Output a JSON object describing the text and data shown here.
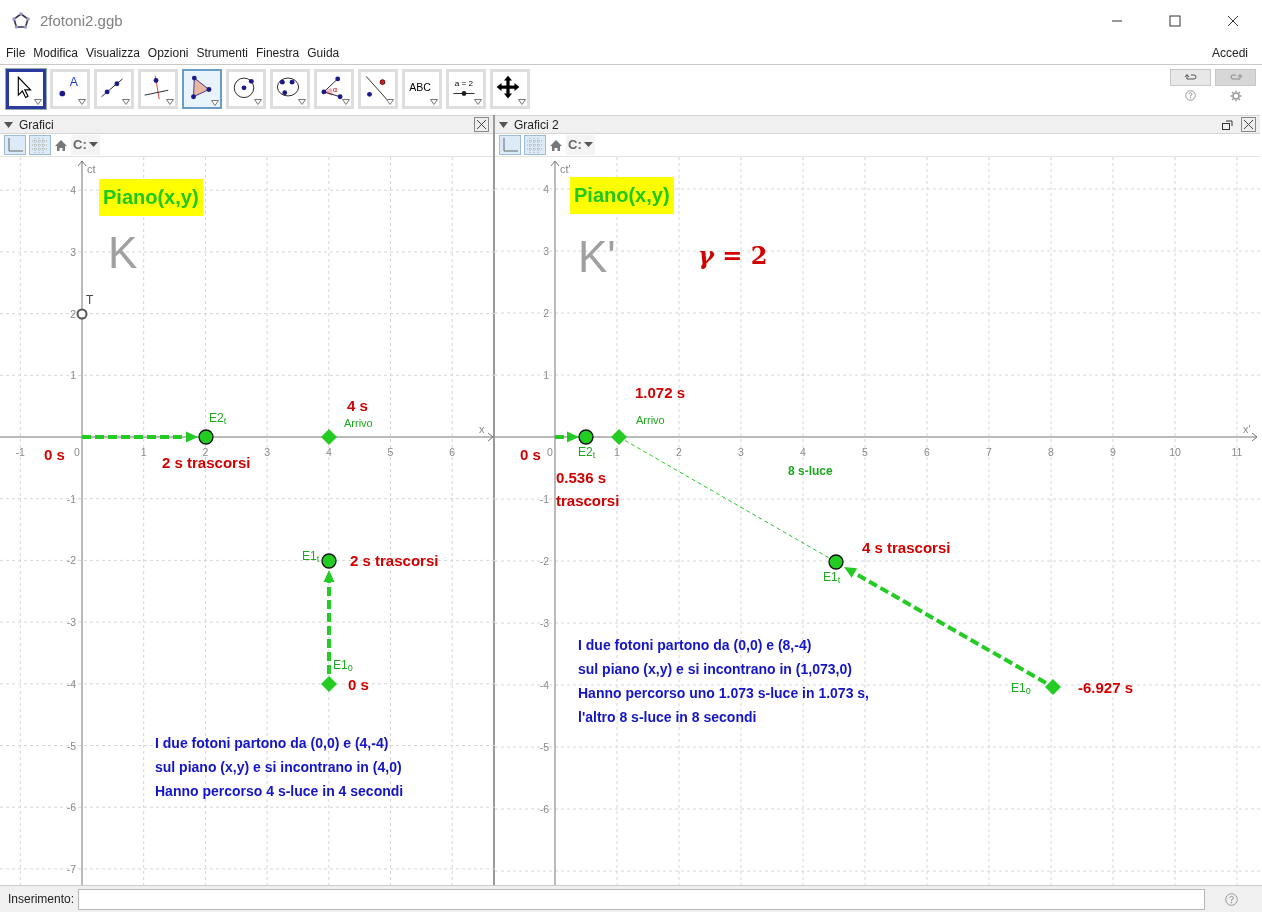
{
  "window": {
    "title": "2fotoni2.ggb"
  },
  "menu": [
    "File",
    "Modifica",
    "Visualizza",
    "Opzioni",
    "Strumenti",
    "Finestra",
    "Guida"
  ],
  "account": "Accedi",
  "tools": [
    {
      "kind": "pointer",
      "selected": true,
      "hovered": false
    },
    {
      "kind": "point",
      "text": "A",
      "selected": false,
      "hovered": false
    },
    {
      "kind": "line",
      "selected": false,
      "hovered": false
    },
    {
      "kind": "perpendicular",
      "selected": false,
      "hovered": false
    },
    {
      "kind": "polygon",
      "selected": false,
      "hovered": true
    },
    {
      "kind": "circle",
      "selected": false,
      "hovered": false
    },
    {
      "kind": "conic",
      "selected": false,
      "hovered": false
    },
    {
      "kind": "angle",
      "text": "α",
      "selected": false,
      "hovered": false
    },
    {
      "kind": "reflect",
      "selected": false,
      "hovered": false
    },
    {
      "kind": "text",
      "text": "ABC",
      "selected": false,
      "hovered": false
    },
    {
      "kind": "slider",
      "text": "a = 2",
      "selected": false,
      "hovered": false
    },
    {
      "kind": "move_view",
      "selected": false,
      "hovered": false
    }
  ],
  "history": {
    "undo_disabled": false,
    "redo_disabled": true
  },
  "panels": [
    {
      "title": "Grafici",
      "detachable": false,
      "style_bar": {
        "axes_on": true,
        "grid_on": true,
        "capture": "C:"
      },
      "axes": {
        "x_label": "x",
        "y_label": "ct",
        "x_ticks": [
          "-1",
          "0",
          "1",
          "2",
          "3",
          "4",
          "5",
          "6"
        ],
        "y_ticks": [
          "4",
          "3",
          "2",
          "1",
          "-1",
          "-2",
          "-3",
          "-4",
          "-5",
          "-6",
          "-7"
        ]
      },
      "points": [
        {
          "kind": "hollow",
          "label": "T"
        },
        {
          "kind": "circle",
          "label": "E2$_{t}$"
        },
        {
          "kind": "diamond"
        },
        {
          "kind": "circle",
          "label": "E1$_{t}$"
        },
        {
          "kind": "diamond",
          "label": "E1$_{0}$"
        }
      ],
      "texts": [
        {
          "kind": "heading",
          "text": "Piano(x,y)"
        },
        {
          "kind": "frame",
          "text": "K"
        },
        {
          "kind": "red",
          "text": "4 s"
        },
        {
          "kind": "green",
          "text": "Arrivo"
        },
        {
          "kind": "red",
          "text": "0 s"
        },
        {
          "kind": "red",
          "text": "2 s trascorsi"
        },
        {
          "kind": "red",
          "text": "2 s trascorsi"
        },
        {
          "kind": "red",
          "text": "0 s"
        },
        {
          "kind": "note",
          "lines": [
            "I due fotoni partono da (0,0) e (4,-4)",
            "sul piano (x,y) e si incontrano in (4,0)",
            "Hanno percorso 4 s-luce in 4 secondi"
          ]
        }
      ]
    },
    {
      "title": "Grafici 2",
      "detachable": true,
      "style_bar": {
        "axes_on": true,
        "grid_on": true,
        "capture": "C:"
      },
      "axes": {
        "x_label": "x'",
        "y_label": "ct'",
        "x_ticks": [
          "0",
          "1",
          "2",
          "3",
          "4",
          "5",
          "6",
          "7",
          "8",
          "9",
          "10",
          "11"
        ],
        "y_ticks": [
          "4",
          "3",
          "2",
          "1",
          "-1",
          "-2",
          "-3",
          "-4",
          "-5",
          "-6"
        ]
      },
      "points": [
        {
          "kind": "circle",
          "label": "E2$_{t}$"
        },
        {
          "kind": "diamond"
        },
        {
          "kind": "circle",
          "label": "E1$_{t}$"
        },
        {
          "kind": "diamond",
          "label": "E1$_{0}$"
        }
      ],
      "texts": [
        {
          "kind": "heading",
          "text": "Piano(x,y)"
        },
        {
          "kind": "frame",
          "text": "K'"
        },
        {
          "kind": "math",
          "text": "*γ* = 2"
        },
        {
          "kind": "red",
          "text": "1.072 s"
        },
        {
          "kind": "green",
          "text": "Arrivo"
        },
        {
          "kind": "red",
          "text": "0 s"
        },
        {
          "kind": "red",
          "text": "0.536 s trascorsi"
        },
        {
          "kind": "green_bold",
          "text": "8 s-luce"
        },
        {
          "kind": "red",
          "text": "4 s trascorsi"
        },
        {
          "kind": "red",
          "text": "-6.927 s"
        },
        {
          "kind": "note",
          "lines": [
            "I due fotoni partono da (0,0) e (8,-4)",
            "sul piano (x,y) e si incontrano in (1,073,0)",
            "Hanno percorso uno 1.073 s-luce in 1.073 s,",
            "l'altro 8 s-luce in 8 secondi"
          ]
        }
      ]
    }
  ],
  "input_bar": {
    "label": "Inserimento:"
  }
}
